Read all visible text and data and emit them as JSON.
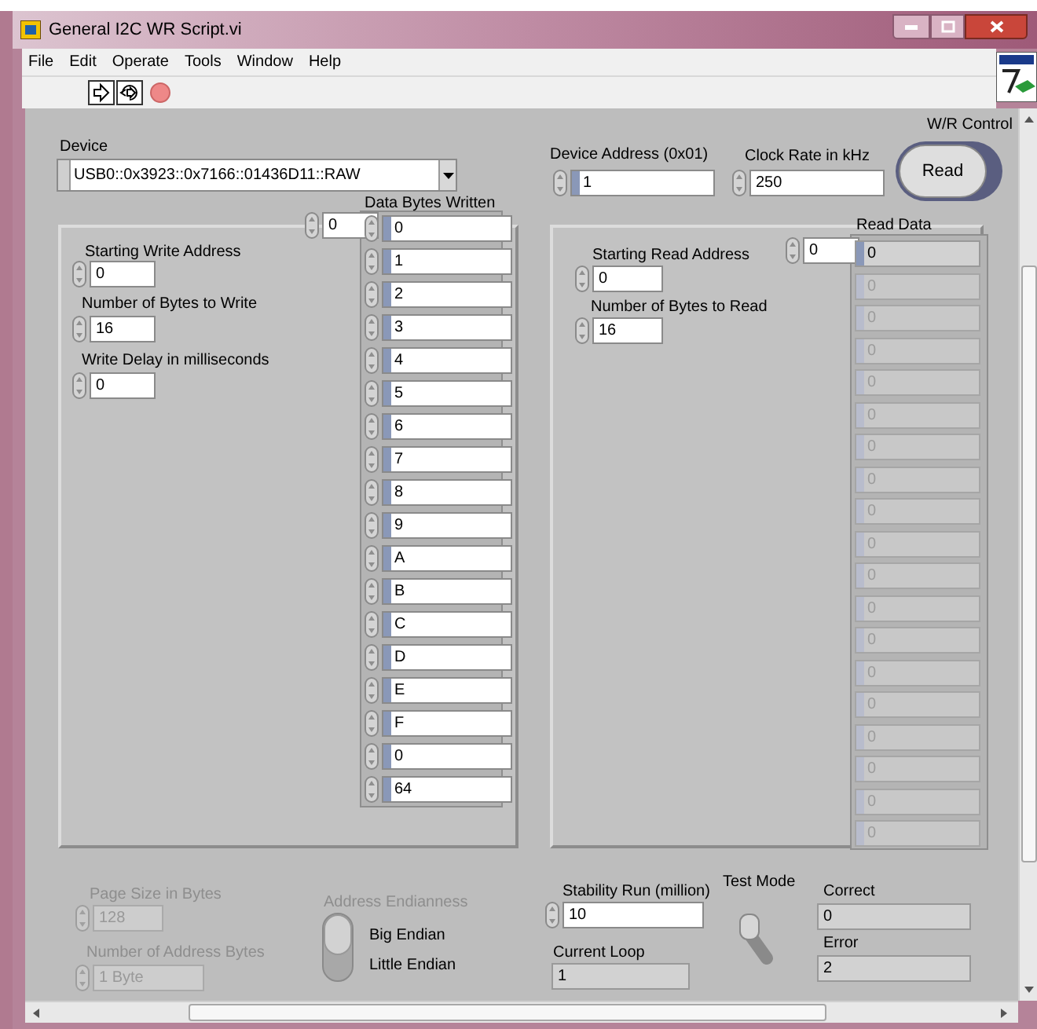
{
  "window": {
    "title": "General I2C WR Script.vi"
  },
  "menu": [
    "File",
    "Edit",
    "Operate",
    "Tools",
    "Window",
    "Help"
  ],
  "device": {
    "label": "Device",
    "value": "USB0::0x3923::0x7166::01436D11::RAW"
  },
  "write": {
    "array_label": "Data Bytes Written",
    "index": "0",
    "fields": [
      {
        "label": "Starting Write Address",
        "value": "0"
      },
      {
        "label": "Number of Bytes to Write",
        "value": "16"
      },
      {
        "label": "Write Delay in milliseconds",
        "value": "0"
      }
    ],
    "values": [
      "0",
      "1",
      "2",
      "3",
      "4",
      "5",
      "6",
      "7",
      "8",
      "9",
      "A",
      "B",
      "C",
      "D",
      "E",
      "F",
      "0",
      "64"
    ]
  },
  "device_address": {
    "label": "Device Address  (0x01)",
    "value": "1"
  },
  "clock_rate": {
    "label": "Clock Rate in kHz",
    "value": "250"
  },
  "wr_control": {
    "label": "W/R Control",
    "button": "Read"
  },
  "read": {
    "array_label": "Read Data",
    "index": "0",
    "fields": [
      {
        "label": "Starting  Read Address",
        "value": "0"
      },
      {
        "label": "Number of Bytes to Read",
        "value": "16"
      }
    ],
    "values": [
      {
        "value": "0",
        "disabled": false
      },
      {
        "value": "0",
        "disabled": true
      },
      {
        "value": "0",
        "disabled": true
      },
      {
        "value": "0",
        "disabled": true
      },
      {
        "value": "0",
        "disabled": true
      },
      {
        "value": "0",
        "disabled": true
      },
      {
        "value": "0",
        "disabled": true
      },
      {
        "value": "0",
        "disabled": true
      },
      {
        "value": "0",
        "disabled": true
      },
      {
        "value": "0",
        "disabled": true
      },
      {
        "value": "0",
        "disabled": true
      },
      {
        "value": "0",
        "disabled": true
      },
      {
        "value": "0",
        "disabled": true
      },
      {
        "value": "0",
        "disabled": true
      },
      {
        "value": "0",
        "disabled": true
      },
      {
        "value": "0",
        "disabled": true
      },
      {
        "value": "0",
        "disabled": true
      },
      {
        "value": "0",
        "disabled": true
      },
      {
        "value": "0",
        "disabled": true
      }
    ]
  },
  "page_size": {
    "label": "Page Size in Bytes",
    "value": "128",
    "disabled": true
  },
  "address_bytes": {
    "label": "Number of Address Bytes",
    "value": "1 Byte",
    "disabled": true
  },
  "endianness": {
    "label": "Address Endianness",
    "disabled": true,
    "options": [
      {
        "label": "Big Endian",
        "selected": true
      },
      {
        "label": "Little Endian",
        "selected": false
      }
    ]
  },
  "stability_run": {
    "label": "Stability Run (million)",
    "value": "10"
  },
  "current_loop": {
    "label": "Current Loop",
    "value": "1"
  },
  "test_mode": {
    "label": "Test Mode",
    "on": false
  },
  "correct": {
    "label": "Correct",
    "value": "0"
  },
  "error": {
    "label": "Error",
    "value": "2"
  }
}
